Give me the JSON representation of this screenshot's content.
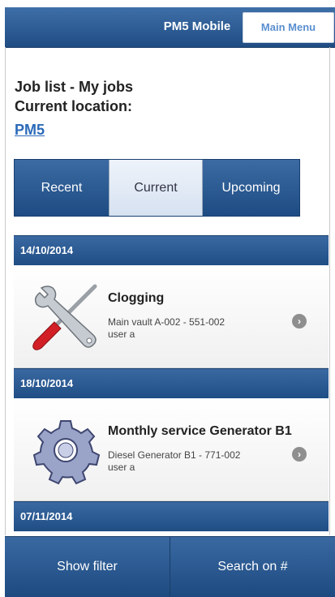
{
  "header": {
    "title": "PM5 Mobile",
    "menu_label": "Main Menu"
  },
  "page": {
    "heading_line1": "Job list - My jobs",
    "heading_line2": "Current location:",
    "location": "PM5"
  },
  "tabs": [
    {
      "label": "Recent",
      "selected": false
    },
    {
      "label": "Current",
      "selected": true
    },
    {
      "label": "Upcoming",
      "selected": false
    }
  ],
  "jobs": [
    {
      "date": "14/10/2014",
      "title": "Clogging",
      "location": "Main vault A-002 - 551-002",
      "user": "user a",
      "icon": "wrench-screwdriver-icon"
    },
    {
      "date": "18/10/2014",
      "title": "Monthly service Generator B1",
      "location": "Diesel Generator B1 - 771-002",
      "user": "user a",
      "icon": "gear-icon"
    }
  ],
  "next_date": "07/11/2014",
  "footer": {
    "filter_label": "Show filter",
    "search_label": "Search on #"
  },
  "colors": {
    "header_blue": "#2b5b94",
    "link_blue": "#2a6ab8",
    "menu_text": "#5b8fd0"
  }
}
